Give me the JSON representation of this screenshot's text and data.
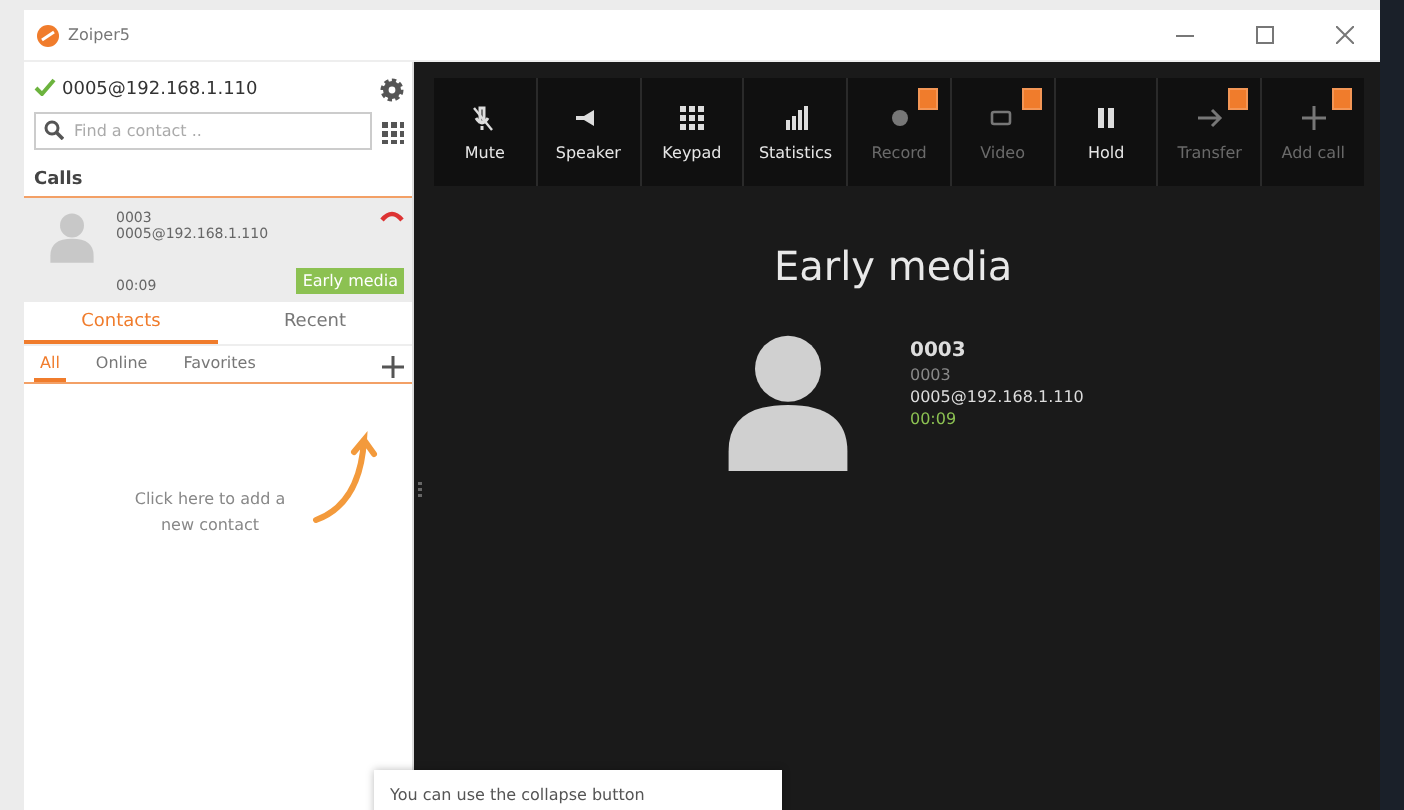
{
  "window": {
    "title": "Zoiper5"
  },
  "account": {
    "name": "0005@192.168.1.110",
    "registered": true
  },
  "search": {
    "placeholder": "Find a contact .."
  },
  "calls_heading": "Calls",
  "calls": [
    {
      "name": "0003",
      "account": "0005@192.168.1.110",
      "duration": "00:09",
      "status": "Early media",
      "selected": true
    }
  ],
  "tabs": [
    {
      "label": "Contacts",
      "selected": true
    },
    {
      "label": "Recent",
      "selected": false
    }
  ],
  "filters": [
    {
      "label": "All",
      "selected": true
    },
    {
      "label": "Online",
      "selected": false
    },
    {
      "label": "Favorites",
      "selected": false
    }
  ],
  "hint": "Click here to add a new contact",
  "toolbar": [
    {
      "kind": "mute",
      "label": "Mute",
      "disabled": false,
      "badge": false
    },
    {
      "kind": "speaker",
      "label": "Speaker",
      "disabled": false,
      "badge": false
    },
    {
      "kind": "keypad",
      "label": "Keypad",
      "disabled": false,
      "badge": false
    },
    {
      "kind": "statistics",
      "label": "Statistics",
      "disabled": false,
      "badge": false
    },
    {
      "kind": "record",
      "label": "Record",
      "disabled": true,
      "badge": true
    },
    {
      "kind": "video",
      "label": "Video",
      "disabled": true,
      "badge": true
    },
    {
      "kind": "hold",
      "label": "Hold",
      "disabled": false,
      "badge": false
    },
    {
      "kind": "transfer",
      "label": "Transfer",
      "disabled": true,
      "badge": true
    },
    {
      "kind": "add",
      "label": "Add call",
      "disabled": true,
      "badge": true
    }
  ],
  "call_view": {
    "status": "Early media",
    "name": "0003",
    "number": "0003",
    "account": "0005@192.168.1.110",
    "duration": "00:09"
  },
  "tooltip": "You can use the collapse button"
}
